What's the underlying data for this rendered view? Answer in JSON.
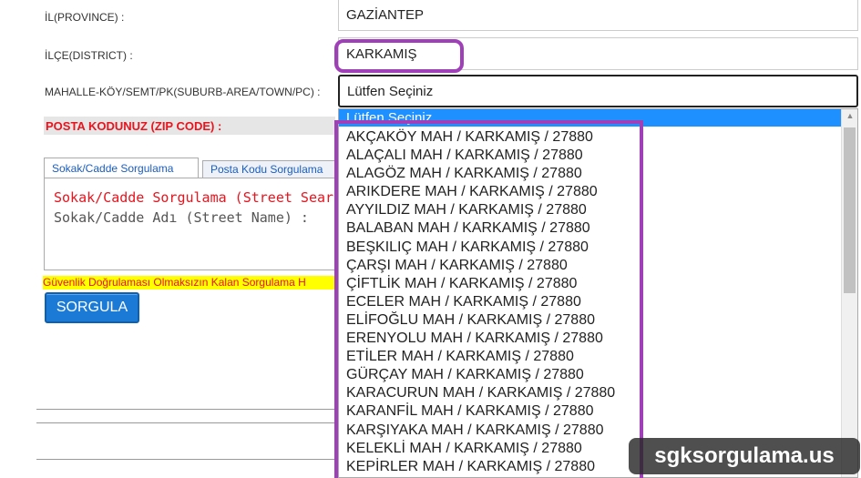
{
  "form": {
    "province_label": "İL(PROVINCE) :",
    "province_value": "GAZİANTEP",
    "district_label": "İLÇE(DISTRICT) :",
    "district_value": "KARKAMIŞ",
    "neighborhood_label": "MAHALLE-KÖY/SEMT/PK(SUBURB-AREA/TOWN/PC) :",
    "neighborhood_value": "Lütfen Seçiniz",
    "zip_label": "POSTA KODUNUZ (ZIP CODE) :"
  },
  "tabs": [
    {
      "label": "Sokak/Cadde Sorgulama"
    },
    {
      "label": "Posta Kodu Sorgulama"
    }
  ],
  "panel": {
    "title": "Sokak/Cadde Sorgulama (Street Search",
    "street_name_label": "Sokak/Cadde Adı (Street Name) :"
  },
  "security_note": "Güvenlik Doğrulaması Olmaksızın Kalan Sorgulama H",
  "query_button": "SORGULA",
  "dropdown": {
    "selected": "Lütfen Seçiniz",
    "options": [
      "AKÇAKÖY MAH / KARKAMIŞ / 27880",
      "ALAÇALI MAH / KARKAMIŞ / 27880",
      "ALAGÖZ MAH / KARKAMIŞ / 27880",
      "ARIKDERE MAH / KARKAMIŞ / 27880",
      "AYYILDIZ MAH / KARKAMIŞ / 27880",
      "BALABAN MAH / KARKAMIŞ / 27880",
      "BEŞKILIÇ MAH / KARKAMIŞ / 27880",
      "ÇARŞI MAH / KARKAMIŞ / 27880",
      "ÇİFTLİK MAH / KARKAMIŞ / 27880",
      "ECELER MAH / KARKAMIŞ / 27880",
      "ELİFOĞLU MAH / KARKAMIŞ / 27880",
      "ERENYOLU MAH / KARKAMIŞ / 27880",
      "ETİLER MAH / KARKAMIŞ / 27880",
      "GÜRÇAY MAH / KARKAMIŞ / 27880",
      "KARACURUN MAH / KARKAMIŞ / 27880",
      "KARANFİL MAH / KARKAMIŞ / 27880",
      "KARŞIYAKA MAH / KARKAMIŞ / 27880",
      "KELEKLİ MAH / KARKAMIŞ / 27880",
      "KEPİRLER MAH / KARKAMIŞ / 27880"
    ]
  },
  "watermark": "sgksorgulama.us",
  "colors": {
    "highlight": "#a040b8",
    "selected_option": "#1e90ff",
    "button": "#1a7ad6",
    "warning_text": "#e8141e",
    "warning_bg": "#ffff00"
  }
}
